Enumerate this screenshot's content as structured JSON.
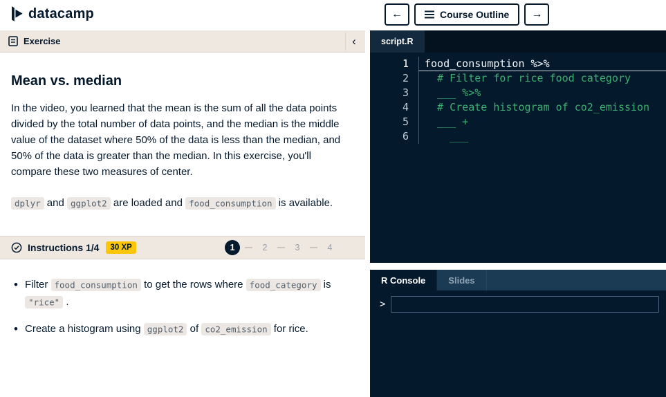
{
  "topbar": {
    "logo_text": "datacamp",
    "nav": {
      "back": "←",
      "course_outline": "Course Outline",
      "forward": "→"
    }
  },
  "exercise_panel": {
    "header_label": "Exercise",
    "collapse_label": "‹",
    "title": "Mean vs. median",
    "intro_paragraph": "In the video, you learned that the mean is the sum of all the data points divided by the total number of data points, and the median is the middle value of the dataset where 50% of the data is less than the median, and 50% of the data is greater than the median. In this exercise, you'll compare these two measures of center.",
    "availability_segments": [
      {
        "type": "code",
        "text": "dplyr"
      },
      {
        "type": "text",
        "text": " and "
      },
      {
        "type": "code",
        "text": "ggplot2"
      },
      {
        "type": "text",
        "text": " are loaded and "
      },
      {
        "type": "code",
        "text": "food_consumption"
      },
      {
        "type": "text",
        "text": " is available."
      }
    ]
  },
  "instructions": {
    "title": "Instructions 1/4",
    "xp_badge": "30 XP",
    "pages": [
      "1",
      "2",
      "3",
      "4"
    ],
    "active_page": "1",
    "bullets": [
      [
        {
          "type": "text",
          "text": "Filter "
        },
        {
          "type": "code",
          "text": "food_consumption"
        },
        {
          "type": "text",
          "text": " to get the rows where "
        },
        {
          "type": "code",
          "text": "food_category"
        },
        {
          "type": "text",
          "text": " is "
        },
        {
          "type": "code",
          "text": "\"rice\""
        },
        {
          "type": "text",
          "text": " ."
        }
      ],
      [
        {
          "type": "text",
          "text": "Create a histogram using "
        },
        {
          "type": "code",
          "text": "ggplot2"
        },
        {
          "type": "text",
          "text": " of "
        },
        {
          "type": "code",
          "text": "co2_emission"
        },
        {
          "type": "text",
          "text": " for rice."
        }
      ]
    ]
  },
  "editor": {
    "tab_label": "script.R",
    "lines": [
      {
        "num": "1",
        "active": true,
        "tokens": [
          {
            "style": "plain",
            "text": "food_consumption %>%"
          }
        ]
      },
      {
        "num": "2",
        "active": false,
        "tokens": [
          {
            "style": "comment",
            "text": "  # Filter for rice food category"
          }
        ]
      },
      {
        "num": "3",
        "active": false,
        "tokens": [
          {
            "style": "comment",
            "text": "  ___ %>%"
          }
        ]
      },
      {
        "num": "4",
        "active": false,
        "tokens": [
          {
            "style": "comment",
            "text": "  # Create histogram of co2_emission"
          }
        ]
      },
      {
        "num": "5",
        "active": false,
        "tokens": [
          {
            "style": "comment",
            "text": "  ___ +"
          }
        ]
      },
      {
        "num": "6",
        "active": false,
        "tokens": [
          {
            "style": "comment",
            "text": "    ___"
          }
        ]
      }
    ]
  },
  "console": {
    "tabs": [
      {
        "label": "R Console",
        "active": true
      },
      {
        "label": "Slides",
        "active": false
      }
    ],
    "prompt": ">",
    "input_value": ""
  },
  "colors": {
    "navy": "#05192d",
    "panel_beige": "#efe8e1",
    "xp_yellow": "#fcc70b",
    "comment_green": "#3baf6f"
  }
}
